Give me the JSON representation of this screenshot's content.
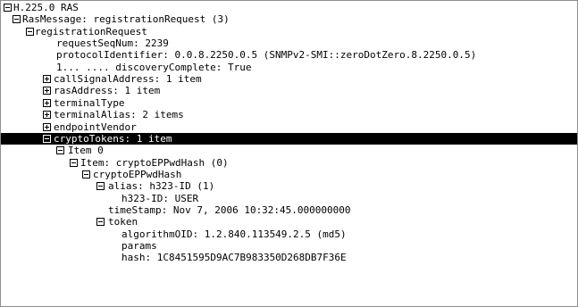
{
  "rows": [
    {
      "text": "H.225.0 RAS",
      "toggle": "minus",
      "selected": false
    },
    {
      "text": "RasMessage: registrationRequest (3)",
      "toggle": "minus",
      "selected": false
    },
    {
      "text": "registrationRequest",
      "toggle": "minus",
      "selected": false
    },
    {
      "text": "requestSeqNum: 2239",
      "toggle": "",
      "selected": false
    },
    {
      "text": "protocolIdentifier: 0.0.8.2250.0.5 (SNMPv2-SMI::zeroDotZero.8.2250.0.5)",
      "toggle": "",
      "selected": false
    },
    {
      "text": "1... .... discoveryComplete: True",
      "toggle": "",
      "selected": false
    },
    {
      "text": "callSignalAddress: 1 item",
      "toggle": "plus",
      "selected": false
    },
    {
      "text": "rasAddress: 1 item",
      "toggle": "plus",
      "selected": false
    },
    {
      "text": "terminalType",
      "toggle": "plus",
      "selected": false
    },
    {
      "text": "terminalAlias: 2 items",
      "toggle": "plus",
      "selected": false
    },
    {
      "text": "endpointVendor",
      "toggle": "plus",
      "selected": false
    },
    {
      "text": "cryptoTokens: 1 item",
      "toggle": "minus",
      "selected": true
    },
    {
      "text": "Item 0",
      "toggle": "minus",
      "selected": false
    },
    {
      "text": "Item: cryptoEPPwdHash (0)",
      "toggle": "minus",
      "selected": false
    },
    {
      "text": "cryptoEPPwdHash",
      "toggle": "minus",
      "selected": false
    },
    {
      "text": "alias: h323-ID (1)",
      "toggle": "minus",
      "selected": false
    },
    {
      "text": "h323-ID: USER",
      "toggle": "",
      "selected": false
    },
    {
      "text": "timeStamp: Nov  7, 2006 10:32:45.000000000",
      "toggle": "",
      "selected": false
    },
    {
      "text": "token",
      "toggle": "minus",
      "selected": false
    },
    {
      "text": "algorithmOID: 1.2.840.113549.2.5 (md5)",
      "toggle": "",
      "selected": false
    },
    {
      "text": "params",
      "toggle": "",
      "selected": false
    },
    {
      "text": "hash: 1C8451595D9AC7B983350D268DB7F36E",
      "toggle": "",
      "selected": false
    }
  ]
}
